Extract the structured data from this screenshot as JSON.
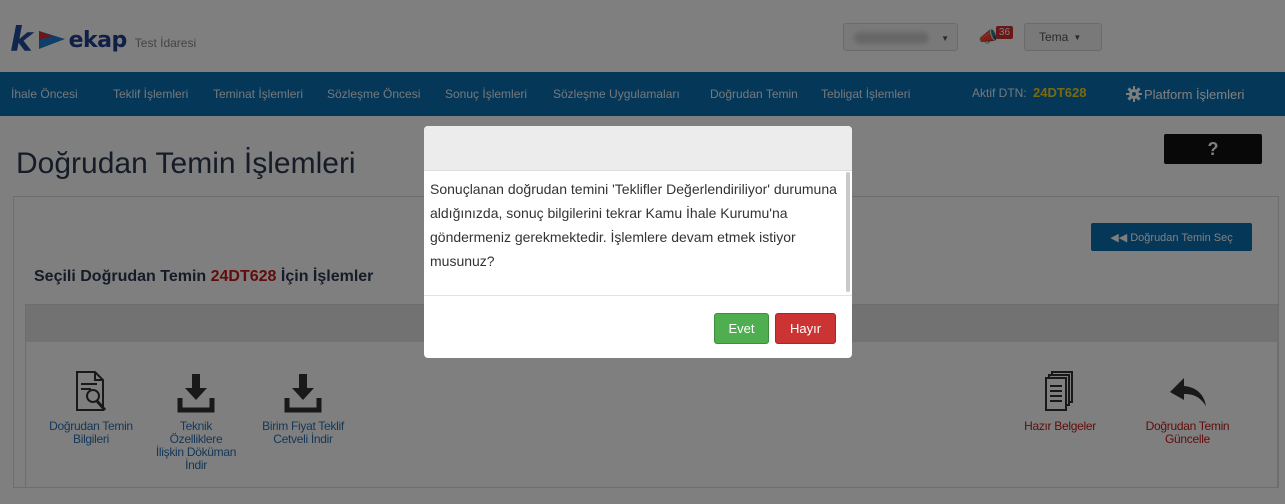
{
  "header": {
    "logo_letter": "k",
    "logo_text": "ekap",
    "logo_subtitle": "Test İdaresi",
    "notification_count": "36",
    "theme_label": "Tema"
  },
  "nav": {
    "items": [
      "İhale Öncesi",
      "Teklif İşlemleri",
      "Teminat İşlemleri",
      "Sözleşme Öncesi",
      "Sonuç İşlemleri",
      "Sözleşme Uygulamaları",
      "Doğrudan Temin",
      "Tebligat İşlemleri"
    ],
    "aktif_label": "Aktif DTN:",
    "aktif_code": "24DT628",
    "platform_label": "Platform İşlemleri"
  },
  "page": {
    "title": "Doğrudan Temin İşlemleri",
    "help_label": "?",
    "select_button": "◀◀ Doğrudan Temin Seç",
    "section_prefix": "Seçili Doğrudan Temin",
    "section_code": "24DT628",
    "section_suffix": "İçin İşlemler",
    "actions": [
      {
        "label_lines": [
          "Doğrudan Temin",
          "Bilgileri"
        ],
        "icon": "document-search-icon"
      },
      {
        "label_lines": [
          "Teknik",
          "Özelliklere",
          "İlişkin Döküman",
          "İndir"
        ],
        "icon": "download-icon"
      },
      {
        "label_lines": [
          "Birim Fiyat Teklif",
          "Cetveli İndir"
        ],
        "icon": "download-icon"
      },
      {
        "label_lines": [
          "Hazır Belgeler"
        ],
        "icon": "documents-stack-icon"
      },
      {
        "label_lines": [
          "Doğrudan Temin",
          "Güncelle"
        ],
        "icon": "reply-arrow-icon"
      }
    ]
  },
  "modal": {
    "message": "Sonuçlanan doğrudan temini 'Teklifler Değerlendiriliyor' durumuna aldığınızda, sonuç bilgilerini tekrar Kamu İhale Kurumu'na göndermeniz gerekmektedir. İşlemlere devam etmek istiyor musunuz?",
    "yes_label": "Evet",
    "no_label": "Hayır"
  },
  "colors": {
    "navbar": "#0b6fb0",
    "accent_yellow": "#f6d21d",
    "code_red": "#c41a1a",
    "yes_green": "#4fae4f",
    "no_red": "#cc3333"
  }
}
